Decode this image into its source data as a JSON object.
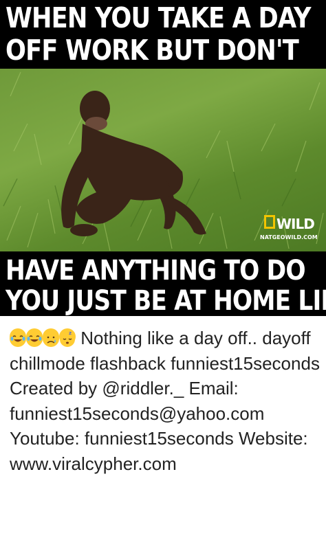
{
  "meme": {
    "top_caption": [
      "WHEN YOU TAKE A DAY",
      "OFF WORK BUT DON'T"
    ],
    "bottom_caption": [
      "HAVE ANYTHING TO DO",
      "YOU JUST BE AT HOME LIKE"
    ],
    "watermark_logo": "WILD",
    "watermark_small": "NATGEOWILD.COM"
  },
  "post": {
    "emojis": [
      "face-with-tears-of-joy",
      "face-with-tears-of-joy",
      "disappointed-relieved-face",
      "sleeping-face"
    ],
    "text": "Nothing like a day off.. dayoff chillmode flashback funniest15seconds Created by @riddler._ Email: funniest15seconds@yahoo.com Youtube: funniest15seconds Website: www.viralcypher.com"
  }
}
